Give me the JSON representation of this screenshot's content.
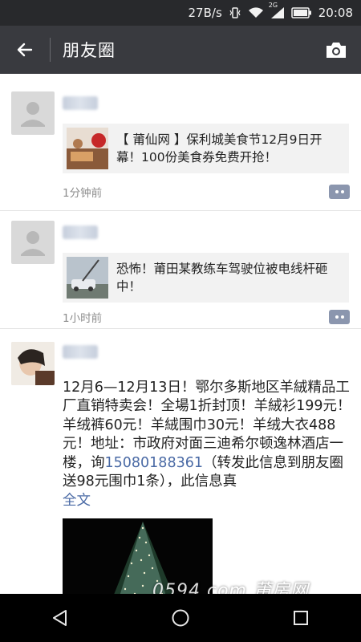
{
  "status_bar": {
    "network_speed": "27B/s",
    "signal_label": "2G",
    "time": "20:08",
    "icons": [
      "vibrate-icon",
      "wifi-icon",
      "signal-icon",
      "battery-icon"
    ]
  },
  "header": {
    "title": "朋友圈",
    "back_icon": "back-arrow-icon",
    "camera_icon": "camera-icon"
  },
  "posts": [
    {
      "type": "link",
      "link_text": "【 莆仙网 】保利城美食节12月9日开幕！100份美食券免费开抢！",
      "time": "1分钟前"
    },
    {
      "type": "link",
      "link_text": "恐怖！莆田某教练车驾驶位被电线杆砸中！",
      "time": "1小时前"
    },
    {
      "type": "text",
      "text_before_phone": "12月6—12月13日！鄂尔多斯地区羊絨精品工厂直销特卖会！全場1折封顶！羊絨衫199元！羊绒裤60元！羊絨围巾30元！羊绒大衣488元！地址：市政府对面三迪希尔顿逸林酒店一楼，询",
      "phone": "15080188361",
      "text_after_phone": "（转发此信息到朋友圈送98元围巾1条），此信息真",
      "full_text_label": "全文"
    }
  ],
  "watermark": "0594.com 莆房网",
  "colors": {
    "status_bar_bg": "#28292c",
    "app_bar_bg": "#393a3f",
    "link_blue": "#4a6aa5",
    "card_bg": "#f2f2f2",
    "comment_button": "#8b96ae"
  }
}
